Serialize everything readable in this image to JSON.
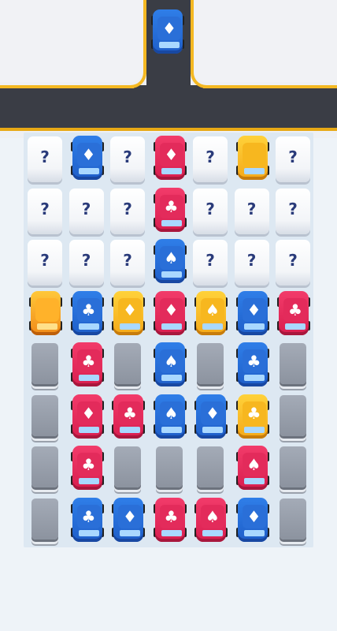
{
  "colors": {
    "blue": "#2f7ee8",
    "red": "#f23b6a",
    "yellow": "#ffd23a",
    "orange": "#f7a520",
    "road": "#3a3d45",
    "road_edge": "#f4b822"
  },
  "hidden_label": "?",
  "road_car": {
    "color": "blue",
    "suit": "♦"
  },
  "grid": [
    [
      {
        "t": "hidden"
      },
      {
        "t": "car",
        "c": "blue",
        "s": "♦"
      },
      {
        "t": "hidden"
      },
      {
        "t": "car",
        "c": "red",
        "s": "♦"
      },
      {
        "t": "hidden"
      },
      {
        "t": "car",
        "c": "yellow",
        "s": ""
      },
      {
        "t": "hidden"
      }
    ],
    [
      {
        "t": "hidden"
      },
      {
        "t": "hidden"
      },
      {
        "t": "hidden"
      },
      {
        "t": "car",
        "c": "red",
        "s": "♣"
      },
      {
        "t": "hidden"
      },
      {
        "t": "hidden"
      },
      {
        "t": "hidden"
      }
    ],
    [
      {
        "t": "hidden"
      },
      {
        "t": "hidden"
      },
      {
        "t": "hidden"
      },
      {
        "t": "car",
        "c": "blue",
        "s": "♠"
      },
      {
        "t": "hidden"
      },
      {
        "t": "hidden"
      },
      {
        "t": "hidden"
      }
    ],
    [
      {
        "t": "car",
        "c": "orange",
        "s": ""
      },
      {
        "t": "car",
        "c": "blue",
        "s": "♣"
      },
      {
        "t": "car",
        "c": "yellow",
        "s": "♦"
      },
      {
        "t": "car",
        "c": "red",
        "s": "♦"
      },
      {
        "t": "car",
        "c": "yellow",
        "s": "♠"
      },
      {
        "t": "car",
        "c": "blue",
        "s": "♦"
      },
      {
        "t": "car",
        "c": "red",
        "s": "♣"
      }
    ],
    [
      {
        "t": "empty"
      },
      {
        "t": "car",
        "c": "red",
        "s": "♣"
      },
      {
        "t": "empty"
      },
      {
        "t": "car",
        "c": "blue",
        "s": "♠"
      },
      {
        "t": "empty"
      },
      {
        "t": "car",
        "c": "blue",
        "s": "♣"
      },
      {
        "t": "empty"
      }
    ],
    [
      {
        "t": "empty"
      },
      {
        "t": "car",
        "c": "red",
        "s": "♦"
      },
      {
        "t": "car",
        "c": "red",
        "s": "♣"
      },
      {
        "t": "car",
        "c": "blue",
        "s": "♠"
      },
      {
        "t": "car",
        "c": "blue",
        "s": "♦"
      },
      {
        "t": "car",
        "c": "yellow",
        "s": "♣"
      },
      {
        "t": "empty"
      }
    ],
    [
      {
        "t": "empty"
      },
      {
        "t": "car",
        "c": "red",
        "s": "♣"
      },
      {
        "t": "empty"
      },
      {
        "t": "empty"
      },
      {
        "t": "empty"
      },
      {
        "t": "car",
        "c": "red",
        "s": "♠"
      },
      {
        "t": "empty"
      }
    ],
    [
      {
        "t": "empty"
      },
      {
        "t": "car",
        "c": "blue",
        "s": "♣"
      },
      {
        "t": "car",
        "c": "blue",
        "s": "♦"
      },
      {
        "t": "car",
        "c": "red",
        "s": "♣"
      },
      {
        "t": "car",
        "c": "red",
        "s": "♠"
      },
      {
        "t": "car",
        "c": "blue",
        "s": "♦"
      },
      {
        "t": "empty"
      }
    ]
  ]
}
